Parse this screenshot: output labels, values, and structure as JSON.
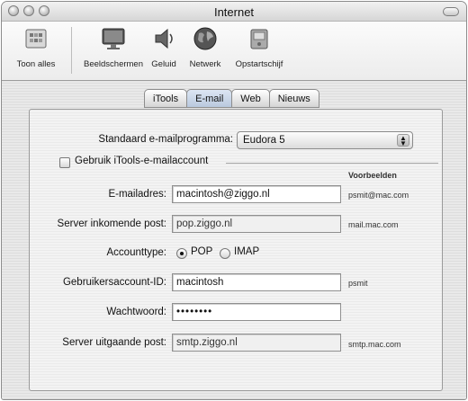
{
  "window": {
    "title": "Internet"
  },
  "toolbar": {
    "items": [
      {
        "label": "Toon alles",
        "icon": "show-all-icon"
      },
      {
        "label": "Beeldschermen",
        "icon": "display-icon"
      },
      {
        "label": "Geluid",
        "icon": "speaker-icon"
      },
      {
        "label": "Netwerk",
        "icon": "globe-icon"
      },
      {
        "label": "Opstartschijf",
        "icon": "disk-icon"
      }
    ]
  },
  "tabs": [
    {
      "label": "iTools",
      "active": false
    },
    {
      "label": "E-mail",
      "active": true
    },
    {
      "label": "Web",
      "active": false
    },
    {
      "label": "Nieuws",
      "active": false
    }
  ],
  "form": {
    "default_client_label": "Standaard e-mailprogramma:",
    "default_client_value": "Eudora 5",
    "use_itools_label": "Gebruik iTools-e-mailaccount",
    "use_itools_checked": false,
    "examples_header": "Voorbeelden",
    "email_label": "E-mailadres:",
    "email_value": "macintosh@ziggo.nl",
    "email_example": "psmit@mac.com",
    "incoming_label": "Server inkomende post:",
    "incoming_value": "pop.ziggo.nl",
    "incoming_example": "mail.mac.com",
    "account_type_label": "Accounttype:",
    "account_type_options": [
      "POP",
      "IMAP"
    ],
    "account_type_selected": "POP",
    "user_id_label": "Gebruikersaccount-ID:",
    "user_id_value": "macintosh",
    "user_id_example": "psmit",
    "password_label": "Wachtwoord:",
    "password_value": "••••••••",
    "outgoing_label": "Server uitgaande post:",
    "outgoing_value": "smtp.ziggo.nl",
    "outgoing_example": "smtp.mac.com"
  }
}
